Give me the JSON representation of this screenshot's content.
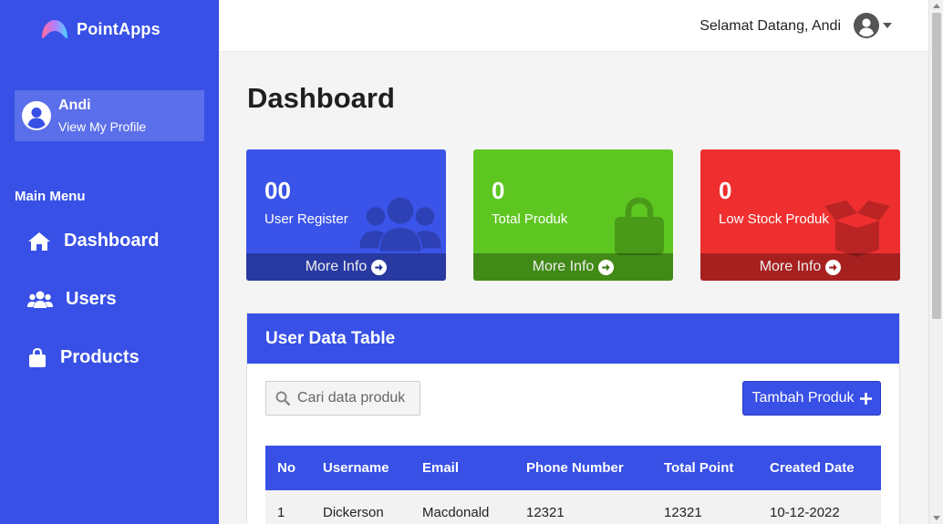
{
  "app": {
    "brand": "PointApps"
  },
  "sidebar": {
    "profile": {
      "name": "Andi",
      "link": "View My Profile"
    },
    "menu_title": "Main Menu",
    "items": [
      {
        "label": "Dashboard",
        "icon": "home-icon"
      },
      {
        "label": "Users",
        "icon": "users-icon"
      },
      {
        "label": "Products",
        "icon": "shopping-bag-icon"
      }
    ]
  },
  "topbar": {
    "greeting": "Selamat Datang, Andi"
  },
  "main": {
    "title": "Dashboard",
    "cards": [
      {
        "value": "00",
        "label": "User Register",
        "footer": "More Info",
        "color": "#3a53e8",
        "icon": "users-icon"
      },
      {
        "value": "0",
        "label": "Total Produk",
        "footer": "More Info",
        "color": "#5ec621",
        "icon": "shopping-bag-icon"
      },
      {
        "value": "0",
        "label": "Low Stock Produk",
        "footer": "More Info",
        "color": "#ef2f2f",
        "icon": "box-open-icon"
      }
    ],
    "table": {
      "title": "User Data Table",
      "search_placeholder": "Cari data produk",
      "add_button": "Tambah Produk",
      "columns": [
        "No",
        "Username",
        "Email",
        "Phone Number",
        "Total Point",
        "Created Date"
      ],
      "rows": [
        [
          "1",
          "Dickerson",
          "Macdonald",
          "12321",
          "12321",
          "10-12-2022"
        ]
      ]
    }
  },
  "colors": {
    "primary": "#3850e6",
    "green": "#5ec621",
    "red": "#ef2f2f",
    "background": "#f4f4f5"
  }
}
